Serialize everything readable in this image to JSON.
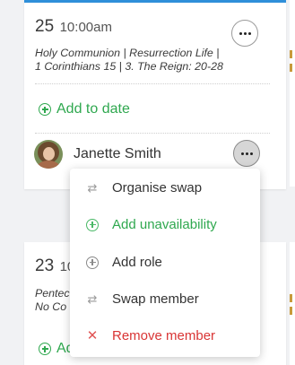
{
  "top_card": {
    "day": "25",
    "time": "10:00am",
    "service_line1": "Holy Communion | Resurrection Life |",
    "service_line2": "1 Corinthians 15 | 3. The Reign: 20-28",
    "add_label": "Add to date",
    "member_name": "Janette Smith"
  },
  "bottom_card": {
    "day": "23",
    "time": "10",
    "service_line1": "Pentec",
    "service_line2": "No Co",
    "add_label": "Add to date"
  },
  "menu": {
    "items": [
      {
        "label": "Organise swap",
        "icon": "swap-icon",
        "tone": "plain"
      },
      {
        "label": "Add unavailability",
        "icon": "plus-circle-icon",
        "tone": "green"
      },
      {
        "label": "Add role",
        "icon": "plus-circle-icon",
        "tone": "plain"
      },
      {
        "label": "Swap member",
        "icon": "swap-icon",
        "tone": "plain"
      },
      {
        "label": "Remove member",
        "icon": "close-icon",
        "tone": "red"
      }
    ]
  },
  "colors": {
    "accent_blue": "#2f8fd9",
    "green": "#2fa84f",
    "red": "#d93535",
    "background": "#f1f2f4"
  }
}
